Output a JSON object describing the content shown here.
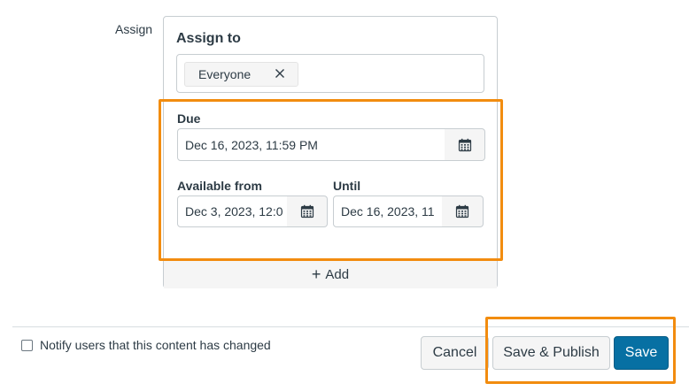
{
  "assign_section": {
    "label": "Assign"
  },
  "card": {
    "title": "Assign to",
    "assignees": [
      {
        "label": "Everyone"
      }
    ],
    "due": {
      "label": "Due",
      "value": "Dec 16, 2023, 11:59 PM"
    },
    "available_from": {
      "label": "Available from",
      "value": "Dec 3, 2023, 12:0"
    },
    "until": {
      "label": "Until",
      "value": "Dec 16, 2023, 11"
    },
    "add_label": "Add"
  },
  "footer": {
    "notify_label": "Notify users that this content has changed",
    "notify_checked": false,
    "cancel_label": "Cancel",
    "save_publish_label": "Save & Publish",
    "save_label": "Save"
  },
  "colors": {
    "highlight": "#f28c0f",
    "primary": "#0770a3",
    "text": "#2d3b45",
    "border": "#c7cdd1"
  },
  "icons": [
    "close-icon",
    "calendar-icon",
    "plus-icon"
  ]
}
